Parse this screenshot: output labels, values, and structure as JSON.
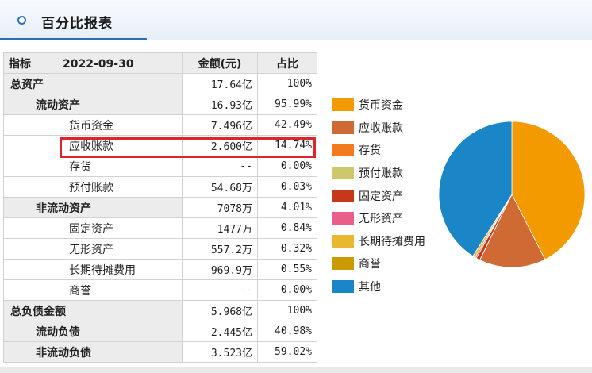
{
  "header": {
    "title": "百分比报表"
  },
  "table": {
    "header_label": "指标",
    "header_date": "2022-09-30",
    "header_amount": "金额(元)",
    "header_ratio": "占比",
    "rows": [
      {
        "label": "总资产",
        "amount": "17.64亿",
        "ratio": "100%",
        "level": 0
      },
      {
        "label": "流动资产",
        "amount": "16.93亿",
        "ratio": "95.99%",
        "level": 1
      },
      {
        "label": "货币资金",
        "amount": "7.496亿",
        "ratio": "42.49%",
        "level": 2
      },
      {
        "label": "应收账款",
        "amount": "2.600亿",
        "ratio": "14.74%",
        "level": 2
      },
      {
        "label": "存货",
        "amount": "--",
        "ratio": "0.00%",
        "level": 2
      },
      {
        "label": "预付账款",
        "amount": "54.68万",
        "ratio": "0.03%",
        "level": 2
      },
      {
        "label": "非流动资产",
        "amount": "7078万",
        "ratio": "4.01%",
        "level": 1
      },
      {
        "label": "固定资产",
        "amount": "1477万",
        "ratio": "0.84%",
        "level": 2
      },
      {
        "label": "无形资产",
        "amount": "557.2万",
        "ratio": "0.32%",
        "level": 2
      },
      {
        "label": "长期待摊费用",
        "amount": "969.9万",
        "ratio": "0.55%",
        "level": 2
      },
      {
        "label": "商誉",
        "amount": "--",
        "ratio": "0.00%",
        "level": 2
      },
      {
        "label": "总负债金额",
        "amount": "5.968亿",
        "ratio": "100%",
        "level": 0
      },
      {
        "label": "流动负债",
        "amount": "2.445亿",
        "ratio": "40.98%",
        "level": 1
      },
      {
        "label": "非流动负债",
        "amount": "3.523亿",
        "ratio": "59.02%",
        "level": 1
      }
    ]
  },
  "chart_data": {
    "type": "pie",
    "categories": [
      "货币资金",
      "应收账款",
      "存货",
      "预付账款",
      "固定资产",
      "无形资产",
      "长期待摊费用",
      "商誉",
      "其他"
    ],
    "values": [
      42.49,
      14.74,
      0.0,
      0.03,
      0.84,
      0.32,
      0.55,
      0.0,
      41.03
    ],
    "colors": [
      "#f39a00",
      "#cf6a35",
      "#f37a1f",
      "#cdc96a",
      "#c5381a",
      "#ea5f8a",
      "#e8b92e",
      "#c89c00",
      "#1a86c8"
    ],
    "legend_position": "left"
  },
  "highlight_color": "#e0242b"
}
